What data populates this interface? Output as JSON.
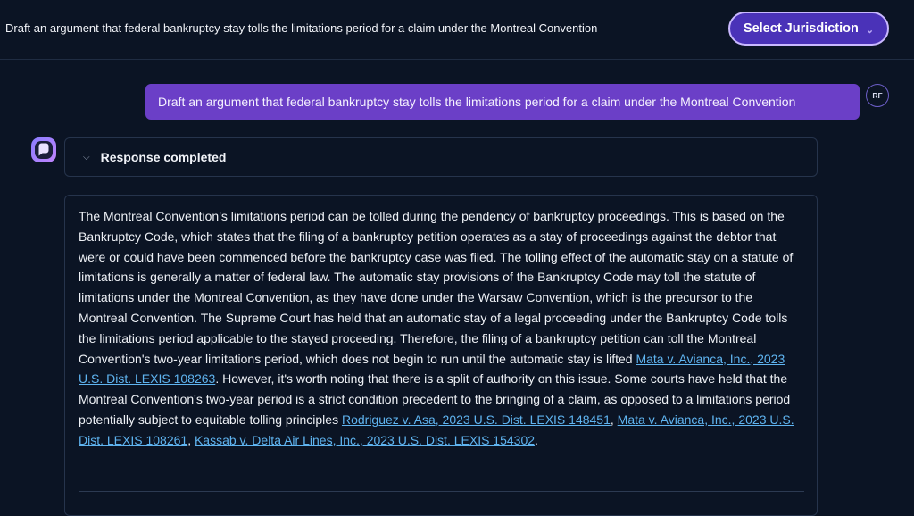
{
  "header": {
    "title": "Draft an argument that federal bankruptcy stay tolls the limitations period for a claim under the Montreal Convention",
    "jurisdiction_button": "Select Jurisdiction",
    "jurisdiction_icon": "chevron-down-icon"
  },
  "conversation": {
    "user_message": "Draft an argument that federal bankruptcy stay tolls the limitations period for a claim under the Montreal Convention",
    "user_avatar": "RF",
    "assistant_icon": "chat-bubble-icon",
    "status_label": "Response completed",
    "status_icon": "chevron-down-icon",
    "response": {
      "text_1": "The Montreal Convention's limitations period can be tolled during the pendency of bankruptcy proceedings. This is based on the Bankruptcy Code, which states that the filing of a bankruptcy petition operates as a stay of proceedings against the debtor that were or could have been commenced before the bankruptcy case was filed. The tolling effect of the automatic stay on a statute of limitations is generally a matter of federal law. The automatic stay provisions of the Bankruptcy Code may toll the statute of limitations under the Montreal Convention, as they have done under the Warsaw Convention, which is the precursor to the Montreal Convention. The Supreme Court has held that an automatic stay of a legal proceeding under the Bankruptcy Code tolls the limitations period applicable to the stayed proceeding. Therefore, the filing of a bankruptcy petition can toll the Montreal Convention's two-year limitations period, which does not begin to run until the automatic stay is lifted ",
      "citation_1": "Mata v. Avianca, Inc., 2023 U.S. Dist. LEXIS 108263",
      "text_2": ". However, it's worth noting that there is a split of authority on this issue. Some courts have held that the Montreal Convention's two-year period is a strict condition precedent to the bringing of a claim, as opposed to a limitations period potentially subject to equitable tolling principles ",
      "citation_2": "Rodriguez v. Asa, 2023 U.S. Dist. LEXIS 148451",
      "sep_1": ", ",
      "citation_3": "Mata v. Avianca, Inc., 2023 U.S. Dist. LEXIS 108261",
      "sep_2": ", ",
      "citation_4": "Kassab v. Delta Air Lines, Inc., 2023 U.S. Dist. LEXIS 154302",
      "text_end": "."
    }
  },
  "colors": {
    "background": "#0b1424",
    "accent_purple": "#6b3fc7",
    "button_purple": "#4a32b8",
    "link_blue": "#5fb4f0",
    "border": "#26344c"
  }
}
